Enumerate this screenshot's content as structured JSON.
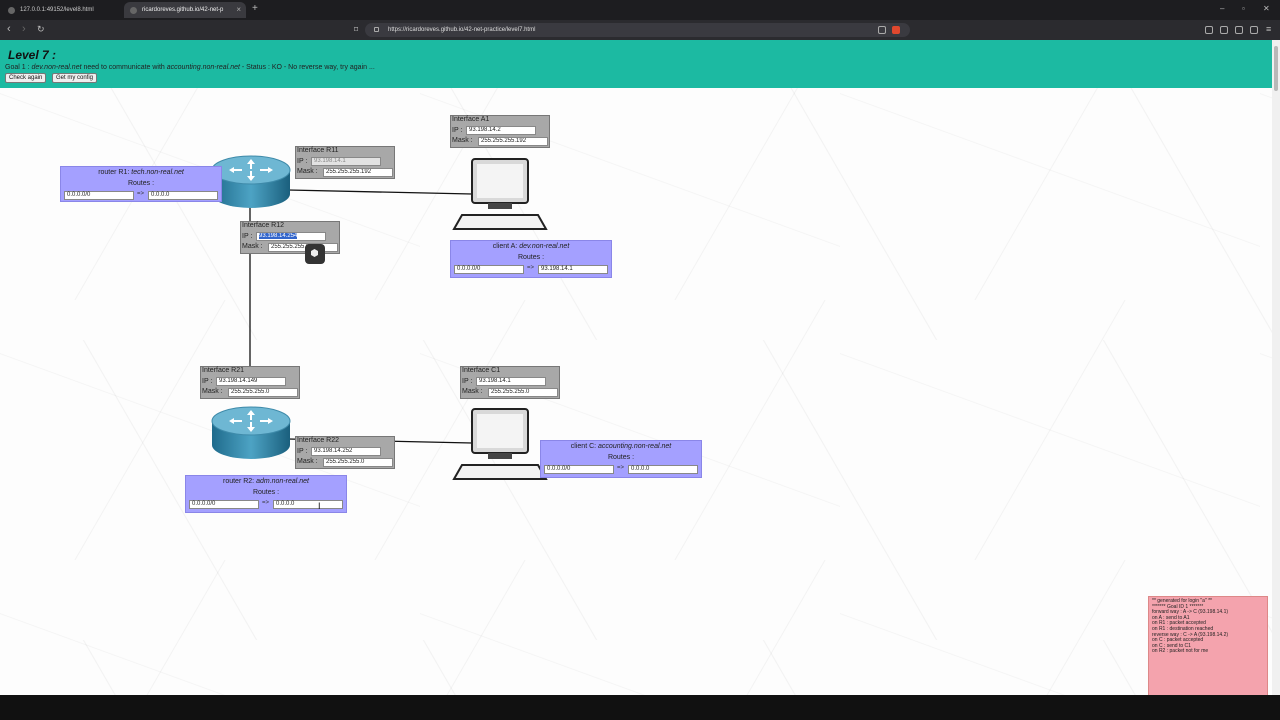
{
  "browser": {
    "tabs": [
      {
        "title": "127.0.0.1:49152/level8.html"
      },
      {
        "title": "ricardoreves.github.io/42-net-p"
      }
    ],
    "url": "https://ricardoreves.github.io/42-net-practice/level7.html"
  },
  "header": {
    "title": "Level 7 :",
    "goal_prefix": "Goal 1 : ",
    "goal_src": "dev.non-real.net",
    "goal_mid": " need to communicate with ",
    "goal_dst": "accounting.non-real.net",
    "goal_status": " - Status : KO - No reverse way, try again ...",
    "check_again": "Check again",
    "get_config": "Get my config"
  },
  "interfaces": {
    "A1": {
      "title": "Interface A1",
      "ip_label": "IP :",
      "ip": "93.198.14.2",
      "mask_label": "Mask :",
      "mask": "255.255.255.192"
    },
    "R11": {
      "title": "Interface R11",
      "ip_label": "IP :",
      "ip": "93.198.14.1",
      "mask_label": "Mask :",
      "mask": "255.255.255.192"
    },
    "R12": {
      "title": "Interface R12",
      "ip_label": "IP :",
      "ip": "93.198.14.254",
      "mask_label": "Mask :",
      "mask": "255.255.255.0"
    },
    "R21": {
      "title": "Interface R21",
      "ip_label": "IP :",
      "ip": "93.198.14.149",
      "mask_label": "Mask :",
      "mask": "255.255.255.0"
    },
    "R22": {
      "title": "Interface R22",
      "ip_label": "IP :",
      "ip": "93.198.14.252",
      "mask_label": "Mask :",
      "mask": "255.255.255.0"
    },
    "C1": {
      "title": "Interface C1",
      "ip_label": "IP :",
      "ip": "93.198.14.1",
      "mask_label": "Mask :",
      "mask": "255.255.255.0"
    }
  },
  "routers": {
    "R1": {
      "prefix": "router R1: ",
      "name": "tech.non-real.net",
      "routes_label": "Routes :",
      "dest": "0.0.0.0/0",
      "arrow": "=>",
      "next_hop": "0.0.0.0"
    },
    "R2": {
      "prefix": "router R2: ",
      "name": "adm.non-real.net",
      "routes_label": "Routes :",
      "dest": "0.0.0.0/0",
      "arrow": "=>",
      "next_hop": "0.0.0.0"
    }
  },
  "clients": {
    "A": {
      "prefix": "client A: ",
      "name": "dev.non-real.net",
      "routes_label": "Routes :",
      "dest": "0.0.0.0/0",
      "arrow": "=>",
      "next_hop": "93.198.14.1"
    },
    "C": {
      "prefix": "client C: ",
      "name": "accounting.non-real.net",
      "routes_label": "Routes :",
      "dest": "0.0.0.0/0",
      "arrow": "=>",
      "next_hop": "0.0.0.0"
    }
  },
  "log": [
    "** generated for login \"a\" **",
    "******* Goal ID 1 *******",
    "forward way : A -> C (93.198.14.1)",
    "on A : send to A1",
    "on R1 : packet accepted",
    "on R1 : destination reached",
    "reverse way : C -> A (93.198.14.2)",
    "on C : packet accepted",
    "on C : send to C1",
    "on R2 : packet not for me"
  ],
  "colors": {
    "header": "#1cbaa2",
    "interface_box": "#a8a8a8",
    "route_box": "#a4a0ff",
    "log_box": "#f4a3ad"
  }
}
